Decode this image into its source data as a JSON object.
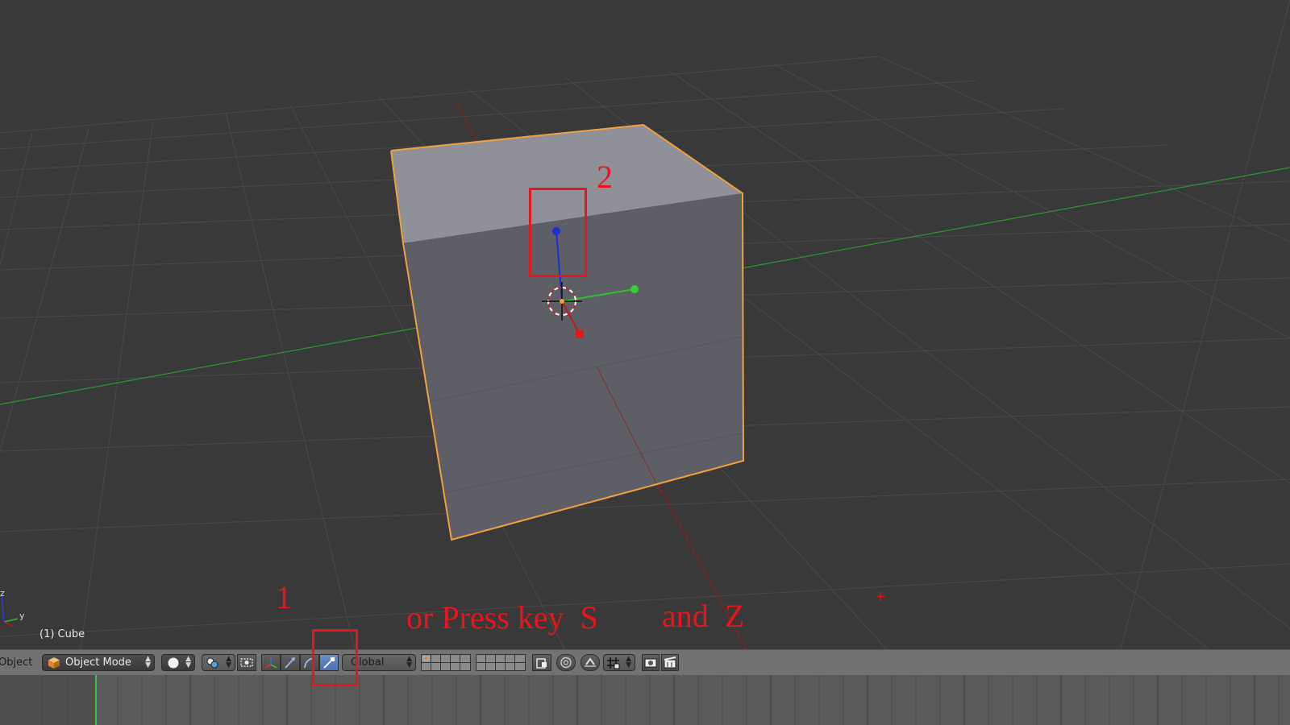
{
  "viewport": {
    "object_label": "(1) Cube",
    "axis_y_label": "y",
    "axis_z_label": "z"
  },
  "annotations": {
    "step1": "1",
    "step2": "2",
    "shortcut_text": "or Press key  S",
    "and_text": "and  Z",
    "plus_mark": "+"
  },
  "header": {
    "menu_object": "Object",
    "mode_dropdown": "Object Mode",
    "orientation_dropdown": "Global"
  },
  "colors": {
    "annotation": "#e8161c",
    "x_axis": "#c21818",
    "y_axis": "#2a9a2a",
    "z_axis": "#1a2fd6",
    "selection_outline": "#f0a040",
    "current_frame": "#40c040"
  },
  "icons": [
    "cube-icon",
    "solid-shading-icon",
    "pivot-point-icon",
    "layers-toggle-icon",
    "manipulator-axes-icon",
    "translate-icon",
    "rotate-icon",
    "scale-icon",
    "layer-grid-icon",
    "layer-grid-icon",
    "lock-layers-icon",
    "proportional-edit-icon",
    "snap-icon",
    "snap-target-icon",
    "render-icon",
    "render-animation-icon"
  ]
}
